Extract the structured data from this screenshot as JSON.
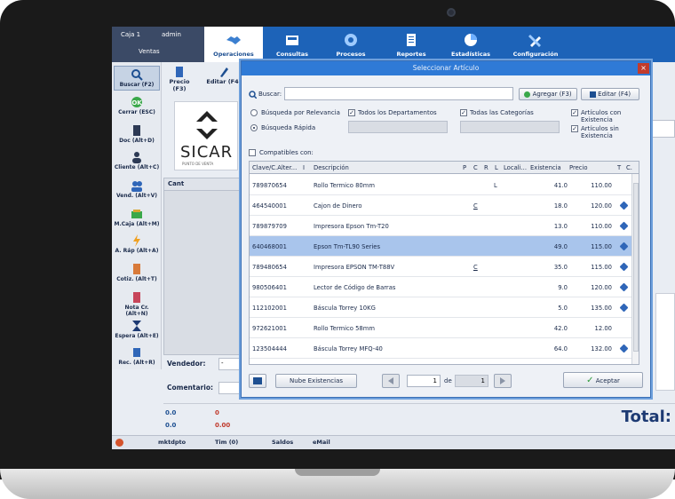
{
  "topbar": {
    "caja": "Caja 1",
    "user": "admin",
    "ventas": "Ventas",
    "nav": [
      {
        "label": "Operaciones",
        "icon": "handshake-icon",
        "active": true
      },
      {
        "label": "Consultas",
        "icon": "register-icon",
        "active": false
      },
      {
        "label": "Procesos",
        "icon": "gear-icon",
        "active": false
      },
      {
        "label": "Reportes",
        "icon": "clipboard-icon",
        "active": false
      },
      {
        "label": "Estadísticas",
        "icon": "pie-chart-icon",
        "active": false
      },
      {
        "label": "Configuración",
        "icon": "tools-icon",
        "active": false
      }
    ]
  },
  "lefttoolbar": [
    {
      "label": "Buscar (F2)",
      "icon": "search-icon"
    },
    {
      "label": "Cerrar (ESC)",
      "icon": "close-icon"
    },
    {
      "label": "Doc (Alt+D)",
      "icon": "document-icon"
    },
    {
      "label": "Cliente (Alt+C)",
      "icon": "client-icon"
    },
    {
      "label": "Vend. (Alt+V)",
      "icon": "seller-icon"
    },
    {
      "label": "M.Caja (Alt+M)",
      "icon": "cash-icon"
    },
    {
      "label": "A. Ráp (Alt+A)",
      "icon": "lightning-icon"
    },
    {
      "label": "Cotiz. (Alt+T)",
      "icon": "quote-icon"
    },
    {
      "label": "Nota Cr. (Alt+N)",
      "icon": "credit-note-icon"
    },
    {
      "label": "Espera (Alt+E)",
      "icon": "hourglass-icon"
    },
    {
      "label": "Rec. (Alt+R)",
      "icon": "recover-icon"
    }
  ],
  "toptoolbar": {
    "precio": "Precio (F3)",
    "editar": "Editar (F4)"
  },
  "logo": {
    "word": "SICAR",
    "tag": "PUNTO DE VENTA"
  },
  "cant_header": "Cant",
  "vendedor_label": "Vendedor:",
  "vendedor_value": "-",
  "comentario_label": "Comentario:",
  "totals": {
    "a": "0.0",
    "b": "0",
    "c": "0.0",
    "d": "0.00",
    "total_label": "Total:"
  },
  "statusbar": {
    "item1": "mktdpto",
    "item2": "Tim (0)",
    "item3": "Saldos",
    "item4": "eMail"
  },
  "dialog": {
    "title": "Seleccionar Artículo",
    "buscar_label": "Buscar:",
    "agregar": "Agregar (F3)",
    "editar": "Editar (F4)",
    "relevancia": "Búsqueda por Relevancia",
    "rapida": "Búsqueda Rápida",
    "todos_dep": "Todos los Departamentos",
    "todas_cat": "Todas las Categorías",
    "con_exist": "Artículos con Existencia",
    "sin_exist": "Artículos sin Existencia",
    "compatibles": "Compatibles con:",
    "columns": [
      "Clave/C.Alter...",
      "I",
      "Descripción",
      "P",
      "C",
      "R",
      "L",
      "Locali...",
      "Existencia",
      "Precio",
      "T",
      "C."
    ],
    "rows": [
      {
        "clave": "789870654",
        "desc": "Rollo Termico 80mm",
        "c": "",
        "l": "L",
        "exist": "41.0",
        "precio": "110.00",
        "tag": false
      },
      {
        "clave": "464540001",
        "desc": "Cajon de Dinero",
        "c": "C",
        "l": "",
        "exist": "18.0",
        "precio": "120.00",
        "tag": true
      },
      {
        "clave": "789879709",
        "desc": "Impresora Epson Tm-T20",
        "c": "",
        "l": "",
        "exist": "13.0",
        "precio": "110.00",
        "tag": true
      },
      {
        "clave": "640468001",
        "desc": "Epson Tm-TL90 Series",
        "c": "",
        "l": "",
        "exist": "49.0",
        "precio": "115.00",
        "tag": true
      },
      {
        "clave": "789480654",
        "desc": "Impresora EPSON TM-T88V",
        "c": "C",
        "l": "",
        "exist": "35.0",
        "precio": "115.00",
        "tag": true
      },
      {
        "clave": "980506401",
        "desc": "Lector de Código de Barras",
        "c": "",
        "l": "",
        "exist": "9.0",
        "precio": "120.00",
        "tag": true
      },
      {
        "clave": "112102001",
        "desc": "Báscula Torrey 10KG",
        "c": "",
        "l": "",
        "exist": "5.0",
        "precio": "135.00",
        "tag": true
      },
      {
        "clave": "972621001",
        "desc": "Rollo Termico 58mm",
        "c": "",
        "l": "",
        "exist": "42.0",
        "precio": "12.00",
        "tag": false
      },
      {
        "clave": "123504444",
        "desc": "Báscula Torrey MFQ-40",
        "c": "",
        "l": "",
        "exist": "64.0",
        "precio": "132.00",
        "tag": true
      }
    ],
    "nube": "Nube Existencias",
    "page": "1",
    "de": "de",
    "pages": "1",
    "aceptar": "Aceptar"
  }
}
